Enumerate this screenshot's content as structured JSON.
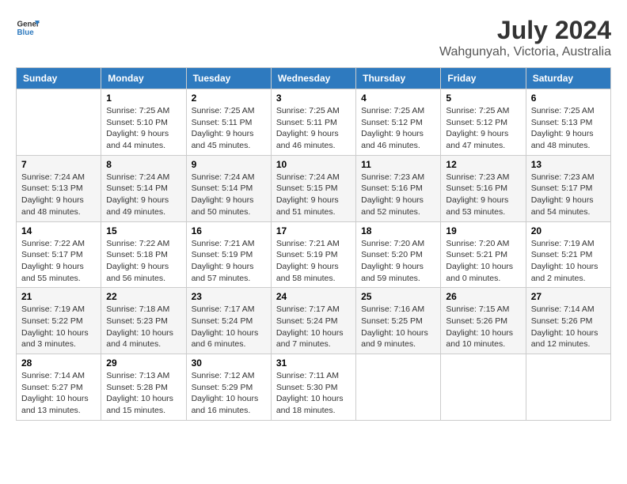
{
  "header": {
    "logo": {
      "line1": "General",
      "line2": "Blue"
    },
    "title": "July 2024",
    "subtitle": "Wahgunyah, Victoria, Australia"
  },
  "days_of_week": [
    "Sunday",
    "Monday",
    "Tuesday",
    "Wednesday",
    "Thursday",
    "Friday",
    "Saturday"
  ],
  "weeks": [
    [
      {
        "day": "",
        "info": ""
      },
      {
        "day": "1",
        "info": "Sunrise: 7:25 AM\nSunset: 5:10 PM\nDaylight: 9 hours\nand 44 minutes."
      },
      {
        "day": "2",
        "info": "Sunrise: 7:25 AM\nSunset: 5:11 PM\nDaylight: 9 hours\nand 45 minutes."
      },
      {
        "day": "3",
        "info": "Sunrise: 7:25 AM\nSunset: 5:11 PM\nDaylight: 9 hours\nand 46 minutes."
      },
      {
        "day": "4",
        "info": "Sunrise: 7:25 AM\nSunset: 5:12 PM\nDaylight: 9 hours\nand 46 minutes."
      },
      {
        "day": "5",
        "info": "Sunrise: 7:25 AM\nSunset: 5:12 PM\nDaylight: 9 hours\nand 47 minutes."
      },
      {
        "day": "6",
        "info": "Sunrise: 7:25 AM\nSunset: 5:13 PM\nDaylight: 9 hours\nand 48 minutes."
      }
    ],
    [
      {
        "day": "7",
        "info": "Sunrise: 7:24 AM\nSunset: 5:13 PM\nDaylight: 9 hours\nand 48 minutes."
      },
      {
        "day": "8",
        "info": "Sunrise: 7:24 AM\nSunset: 5:14 PM\nDaylight: 9 hours\nand 49 minutes."
      },
      {
        "day": "9",
        "info": "Sunrise: 7:24 AM\nSunset: 5:14 PM\nDaylight: 9 hours\nand 50 minutes."
      },
      {
        "day": "10",
        "info": "Sunrise: 7:24 AM\nSunset: 5:15 PM\nDaylight: 9 hours\nand 51 minutes."
      },
      {
        "day": "11",
        "info": "Sunrise: 7:23 AM\nSunset: 5:16 PM\nDaylight: 9 hours\nand 52 minutes."
      },
      {
        "day": "12",
        "info": "Sunrise: 7:23 AM\nSunset: 5:16 PM\nDaylight: 9 hours\nand 53 minutes."
      },
      {
        "day": "13",
        "info": "Sunrise: 7:23 AM\nSunset: 5:17 PM\nDaylight: 9 hours\nand 54 minutes."
      }
    ],
    [
      {
        "day": "14",
        "info": "Sunrise: 7:22 AM\nSunset: 5:17 PM\nDaylight: 9 hours\nand 55 minutes."
      },
      {
        "day": "15",
        "info": "Sunrise: 7:22 AM\nSunset: 5:18 PM\nDaylight: 9 hours\nand 56 minutes."
      },
      {
        "day": "16",
        "info": "Sunrise: 7:21 AM\nSunset: 5:19 PM\nDaylight: 9 hours\nand 57 minutes."
      },
      {
        "day": "17",
        "info": "Sunrise: 7:21 AM\nSunset: 5:19 PM\nDaylight: 9 hours\nand 58 minutes."
      },
      {
        "day": "18",
        "info": "Sunrise: 7:20 AM\nSunset: 5:20 PM\nDaylight: 9 hours\nand 59 minutes."
      },
      {
        "day": "19",
        "info": "Sunrise: 7:20 AM\nSunset: 5:21 PM\nDaylight: 10 hours\nand 0 minutes."
      },
      {
        "day": "20",
        "info": "Sunrise: 7:19 AM\nSunset: 5:21 PM\nDaylight: 10 hours\nand 2 minutes."
      }
    ],
    [
      {
        "day": "21",
        "info": "Sunrise: 7:19 AM\nSunset: 5:22 PM\nDaylight: 10 hours\nand 3 minutes."
      },
      {
        "day": "22",
        "info": "Sunrise: 7:18 AM\nSunset: 5:23 PM\nDaylight: 10 hours\nand 4 minutes."
      },
      {
        "day": "23",
        "info": "Sunrise: 7:17 AM\nSunset: 5:24 PM\nDaylight: 10 hours\nand 6 minutes."
      },
      {
        "day": "24",
        "info": "Sunrise: 7:17 AM\nSunset: 5:24 PM\nDaylight: 10 hours\nand 7 minutes."
      },
      {
        "day": "25",
        "info": "Sunrise: 7:16 AM\nSunset: 5:25 PM\nDaylight: 10 hours\nand 9 minutes."
      },
      {
        "day": "26",
        "info": "Sunrise: 7:15 AM\nSunset: 5:26 PM\nDaylight: 10 hours\nand 10 minutes."
      },
      {
        "day": "27",
        "info": "Sunrise: 7:14 AM\nSunset: 5:26 PM\nDaylight: 10 hours\nand 12 minutes."
      }
    ],
    [
      {
        "day": "28",
        "info": "Sunrise: 7:14 AM\nSunset: 5:27 PM\nDaylight: 10 hours\nand 13 minutes."
      },
      {
        "day": "29",
        "info": "Sunrise: 7:13 AM\nSunset: 5:28 PM\nDaylight: 10 hours\nand 15 minutes."
      },
      {
        "day": "30",
        "info": "Sunrise: 7:12 AM\nSunset: 5:29 PM\nDaylight: 10 hours\nand 16 minutes."
      },
      {
        "day": "31",
        "info": "Sunrise: 7:11 AM\nSunset: 5:30 PM\nDaylight: 10 hours\nand 18 minutes."
      },
      {
        "day": "",
        "info": ""
      },
      {
        "day": "",
        "info": ""
      },
      {
        "day": "",
        "info": ""
      }
    ]
  ]
}
